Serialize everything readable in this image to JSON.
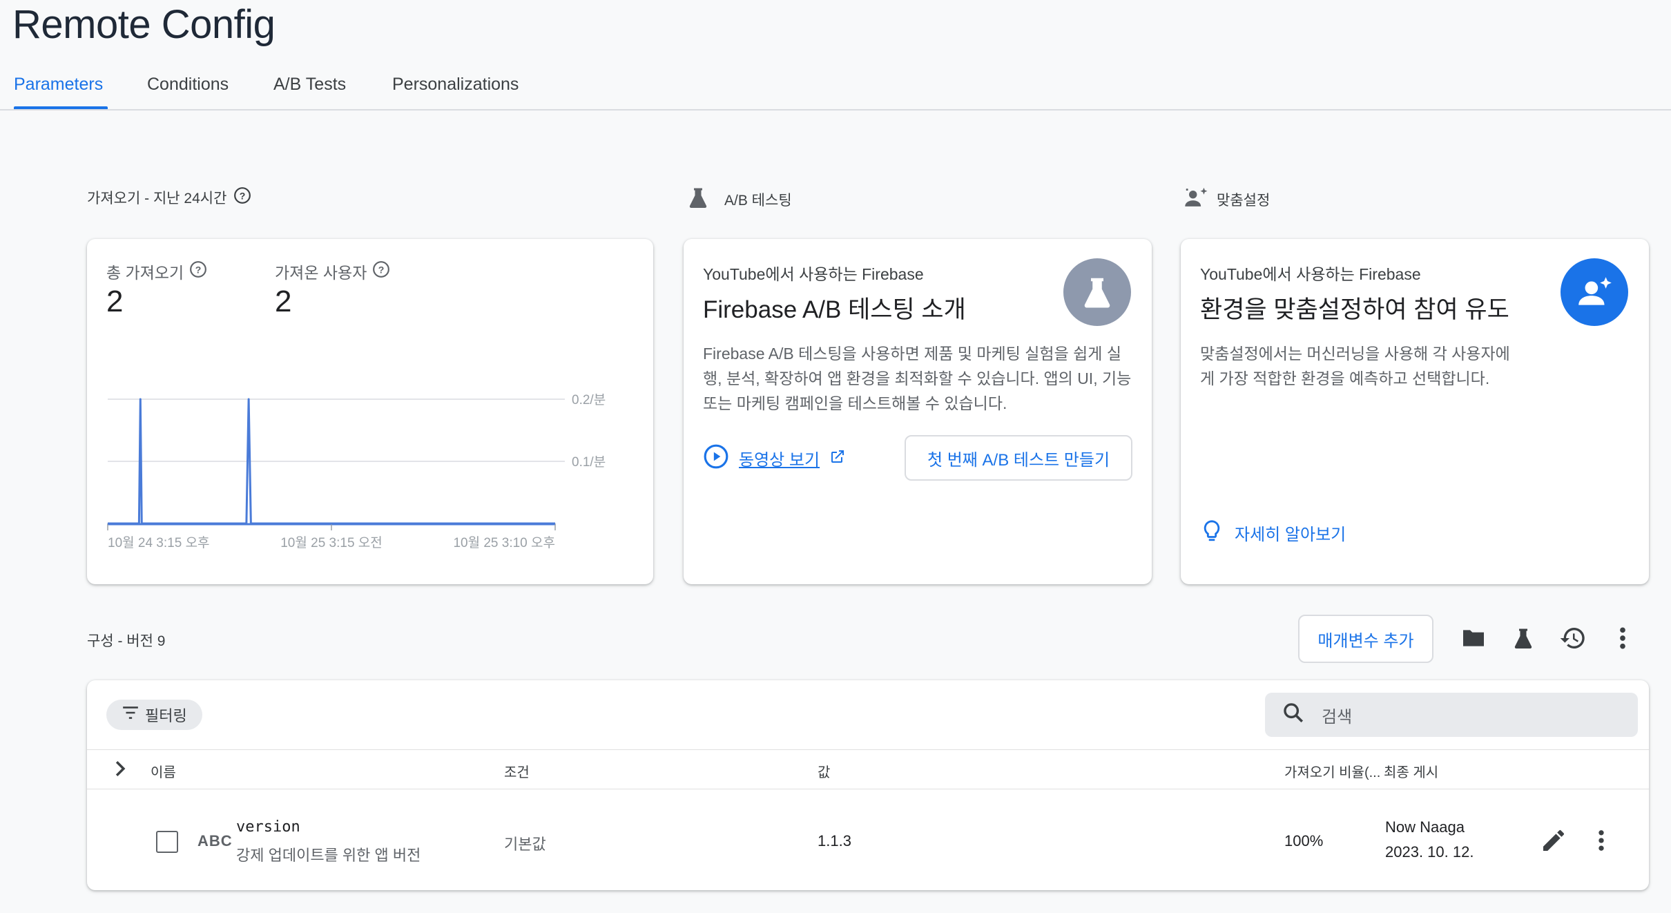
{
  "page": {
    "title": "Remote Config"
  },
  "tabs": [
    {
      "label": "Parameters",
      "active": true
    },
    {
      "label": "Conditions",
      "active": false
    },
    {
      "label": "A/B Tests",
      "active": false
    },
    {
      "label": "Personalizations",
      "active": false
    }
  ],
  "fetch": {
    "section_label": "가져오기 - 지난 24시간",
    "total_label": "총 가져오기",
    "total_value": "2",
    "users_label": "가져온 사용자",
    "users_value": "2",
    "chart_data": {
      "type": "line",
      "y_tick_labels": [
        "0.2/분",
        "0.1/분"
      ],
      "x_tick_labels": [
        "10월 24 3:15 오후",
        "10월 25 3:15 오전",
        "10월 25 3:10 오후"
      ],
      "ylim": [
        0,
        0.2
      ],
      "series": [
        {
          "x": [
            0,
            0.07,
            0.073,
            0.076,
            0.31,
            0.315,
            0.32,
            1.0
          ],
          "values": [
            0,
            0,
            0.2,
            0,
            0,
            0.2,
            0,
            0
          ]
        }
      ],
      "grid": true
    }
  },
  "ab": {
    "section_label": "A/B 테스팅",
    "eyebrow": "YouTube에서 사용하는 Firebase",
    "title": "Firebase A/B 테스팅 소개",
    "body": "Firebase A/B 테스팅을 사용하면 제품 및 마케팅 실험을 쉽게 실행, 분석, 확장하여 앱 환경을 최적화할 수 있습니다. 앱의 UI, 기능 또는 마케팅 캠페인을 테스트해볼 수 있습니다.",
    "video_link": "동영상 보기",
    "create_button": "첫 번째 A/B 테스트 만들기",
    "icon": "flask-icon"
  },
  "personalization": {
    "section_label": "맞춤설정",
    "eyebrow": "YouTube에서 사용하는 Firebase",
    "title": "환경을 맞춤설정하여 참여 유도",
    "body": "맞춤설정에서는 머신러닝을 사용해 각 사용자에게 가장 적합한 환경을 예측하고 선택합니다.",
    "learn_link": "자세히 알아보기",
    "icon": "person-sparkle-icon",
    "accent": "#1a73e8"
  },
  "config": {
    "section_label": "구성 - 버전 9",
    "add_param_button": "매개변수 추가",
    "filter_label": "필터링",
    "search_placeholder": "검색",
    "columns": {
      "name": "이름",
      "condition": "조건",
      "value": "값",
      "fetch_ratio": "가져오기 비율(...",
      "last_published": "최종 게시"
    },
    "rows": [
      {
        "type_badge": "ABC",
        "name": "version",
        "description": "강제 업데이트를 위한 앱 버전",
        "condition": "기본값",
        "value": "1.1.3",
        "fetch_ratio": "100%",
        "published_by": "Now Naaga",
        "published_date": "2023. 10. 12."
      }
    ]
  }
}
